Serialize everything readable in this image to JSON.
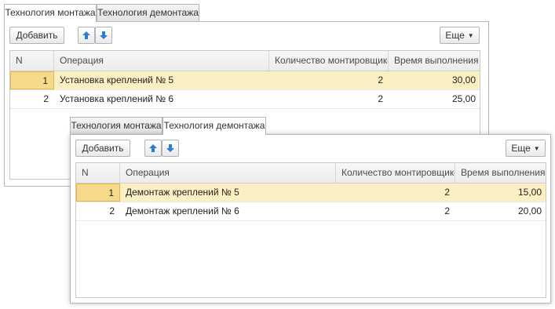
{
  "mount_form": {
    "tabs": [
      "Технология монтажа",
      "Технология демонтажа"
    ],
    "add_label": "Добавить",
    "more_label": "Еще",
    "columns": [
      "N",
      "Операция",
      "Количество монтировщиков",
      "Время выполнения"
    ],
    "rows": [
      {
        "n": "1",
        "operation": "Установка креплений № 5",
        "count": "2",
        "time": "30,00"
      },
      {
        "n": "2",
        "operation": "Установка креплений № 6",
        "count": "2",
        "time": "25,00"
      }
    ]
  },
  "dismount_form": {
    "tabs": [
      "Технология монтажа",
      "Технология демонтажа"
    ],
    "add_label": "Добавить",
    "more_label": "Еще",
    "columns": [
      "N",
      "Операция",
      "Количество монтировщиков",
      "Время выполнения"
    ],
    "rows": [
      {
        "n": "1",
        "operation": "Демонтаж креплений № 5",
        "count": "2",
        "time": "15,00"
      },
      {
        "n": "2",
        "operation": "Демонтаж креплений № 6",
        "count": "2",
        "time": "20,00"
      }
    ]
  },
  "colors": {
    "selected_row": "#fbf0c4",
    "current_cell": "#f7d98b",
    "arrow_blue": "#2a7fd4"
  },
  "icons": {
    "move_up": "arrow-up-icon",
    "move_down": "arrow-down-icon",
    "dropdown": "caret-down-icon"
  }
}
